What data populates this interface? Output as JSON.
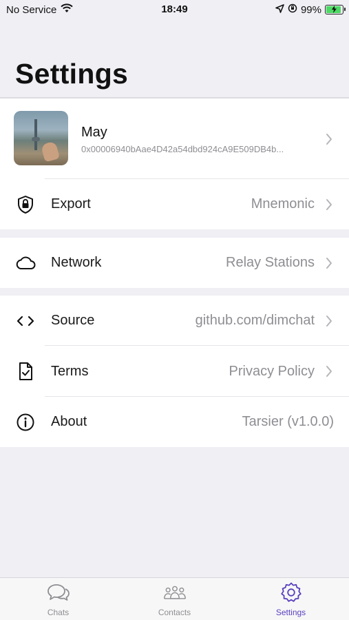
{
  "status_bar": {
    "carrier": "No Service",
    "time": "18:49",
    "battery": "99%",
    "battery_level": 0.99,
    "icons": [
      "wifi-icon",
      "location-arrow-icon",
      "orientation-lock-icon",
      "battery-charging-icon"
    ]
  },
  "header": {
    "title": "Settings"
  },
  "profile": {
    "name": "May",
    "id": "0x00006940bAae4D42a54dbd924cA9E509DB4b...",
    "avatar": "profile-photo"
  },
  "sections": {
    "export": {
      "label": "Export",
      "value": "Mnemonic",
      "icon": "shield-lock-icon"
    },
    "network": {
      "label": "Network",
      "value": "Relay Stations",
      "icon": "cloud-icon"
    },
    "source": {
      "label": "Source",
      "value": "github.com/dimchat",
      "icon": "code-icon"
    },
    "terms": {
      "label": "Terms",
      "value": "Privacy Policy",
      "icon": "document-check-icon"
    },
    "about": {
      "label": "About",
      "value": "Tarsier (v1.0.0)",
      "icon": "info-icon"
    }
  },
  "tab_bar": {
    "tabs": [
      {
        "label": "Chats",
        "icon": "chat-bubbles-icon"
      },
      {
        "label": "Contacts",
        "icon": "contacts-icon"
      },
      {
        "label": "Settings",
        "icon": "gear-icon",
        "active": true
      }
    ]
  },
  "colors": {
    "accent": "#5a3fbf",
    "background": "#efeff4",
    "secondary_text": "#8e8e93",
    "battery_fill": "#4cd964"
  }
}
